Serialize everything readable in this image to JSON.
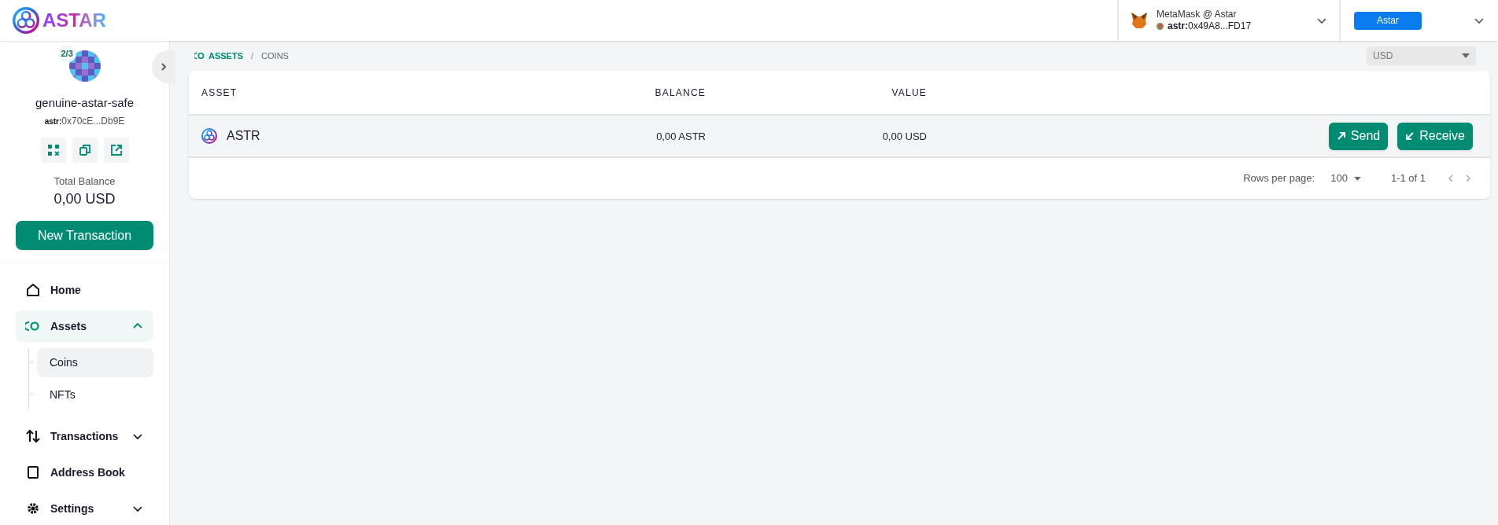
{
  "header": {
    "logo_text": "ASTAR",
    "wallet": {
      "name": "MetaMask @ Astar",
      "address_prefix": "astr:",
      "address": "0x49A8...FD17"
    },
    "network": {
      "label": "Astar"
    }
  },
  "sidebar": {
    "safe": {
      "threshold": "2/3",
      "name": "genuine-astar-safe",
      "address_prefix": "astr:",
      "address": "0x70cE...Db9E"
    },
    "balance_label": "Total Balance",
    "balance": "0,00 USD",
    "new_transaction": "New Transaction",
    "nav": [
      {
        "kind": "link",
        "label": "Home",
        "selected": false
      },
      {
        "kind": "group",
        "label": "Assets",
        "selected": true,
        "expanded": true,
        "children": [
          {
            "label": "Coins",
            "selected": true
          },
          {
            "label": "NFTs",
            "selected": false
          }
        ]
      },
      {
        "kind": "group",
        "label": "Transactions",
        "selected": false,
        "expanded": false
      },
      {
        "kind": "link",
        "label": "Address Book",
        "selected": false
      },
      {
        "kind": "group",
        "label": "Settings",
        "selected": false,
        "expanded": false
      }
    ]
  },
  "breadcrumb": {
    "separator": "/",
    "items": [
      {
        "label": "ASSETS",
        "selected": true
      },
      {
        "label": "COINS",
        "selected": false
      }
    ]
  },
  "currency": {
    "value": "USD"
  },
  "table": {
    "columns": [
      "ASSET",
      "BALANCE",
      "VALUE"
    ],
    "rows": [
      {
        "asset": "ASTR",
        "balance": "0,00 ASTR",
        "value": "0,00 USD",
        "actions": [
          "Send",
          "Receive"
        ]
      }
    ],
    "footer": {
      "rows_per_page_label": "Rows per page:",
      "rows_per_page": "100",
      "range": "1-1 of 1"
    }
  }
}
